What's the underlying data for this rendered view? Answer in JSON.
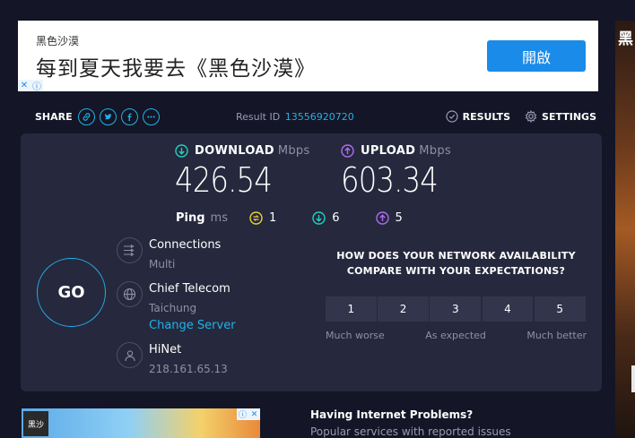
{
  "ad_top": {
    "brand": "黑色沙漠",
    "headline": "每到夏天我要去《黑色沙漠》",
    "cta": "開啟",
    "choices_close": "✕",
    "choices_info": "ⓘ"
  },
  "ad_side": {
    "glyph": "黑"
  },
  "toolbar": {
    "share_label": "SHARE",
    "result_label": "Result ID",
    "result_id": "13556920720",
    "results_label": "RESULTS",
    "settings_label": "SETTINGS"
  },
  "download": {
    "label": "DOWNLOAD",
    "unit": "Mbps",
    "value": "426.54"
  },
  "upload": {
    "label": "UPLOAD",
    "unit": "Mbps",
    "value": "603.34"
  },
  "ping": {
    "label": "Ping",
    "unit": "ms",
    "idle": "1",
    "download": "6",
    "upload": "5"
  },
  "go_label": "GO",
  "connections": {
    "title": "Connections",
    "value": "Multi"
  },
  "server": {
    "name": "Chief Telecom",
    "location": "Taichung",
    "change": "Change Server"
  },
  "isp": {
    "name": "HiNet",
    "ip": "218.161.65.13"
  },
  "survey": {
    "question_line1": "HOW DOES YOUR NETWORK AVAILABILITY",
    "question_line2": "COMPARE WITH YOUR EXPECTATIONS?",
    "options": [
      "1",
      "2",
      "3",
      "4",
      "5"
    ],
    "label_low": "Much worse",
    "label_mid": "As expected",
    "label_high": "Much better"
  },
  "ad_bottom": {
    "logo_text": "黑沙"
  },
  "help": {
    "title": "Having Internet Problems?",
    "subtitle": "Popular services with reported issues"
  },
  "colors": {
    "accent": "#1fb3e8",
    "download": "#1fd1c0",
    "upload": "#b06cf0",
    "ping_idle": "#e8d33a",
    "background": "#141526",
    "panel": "#26283d"
  }
}
